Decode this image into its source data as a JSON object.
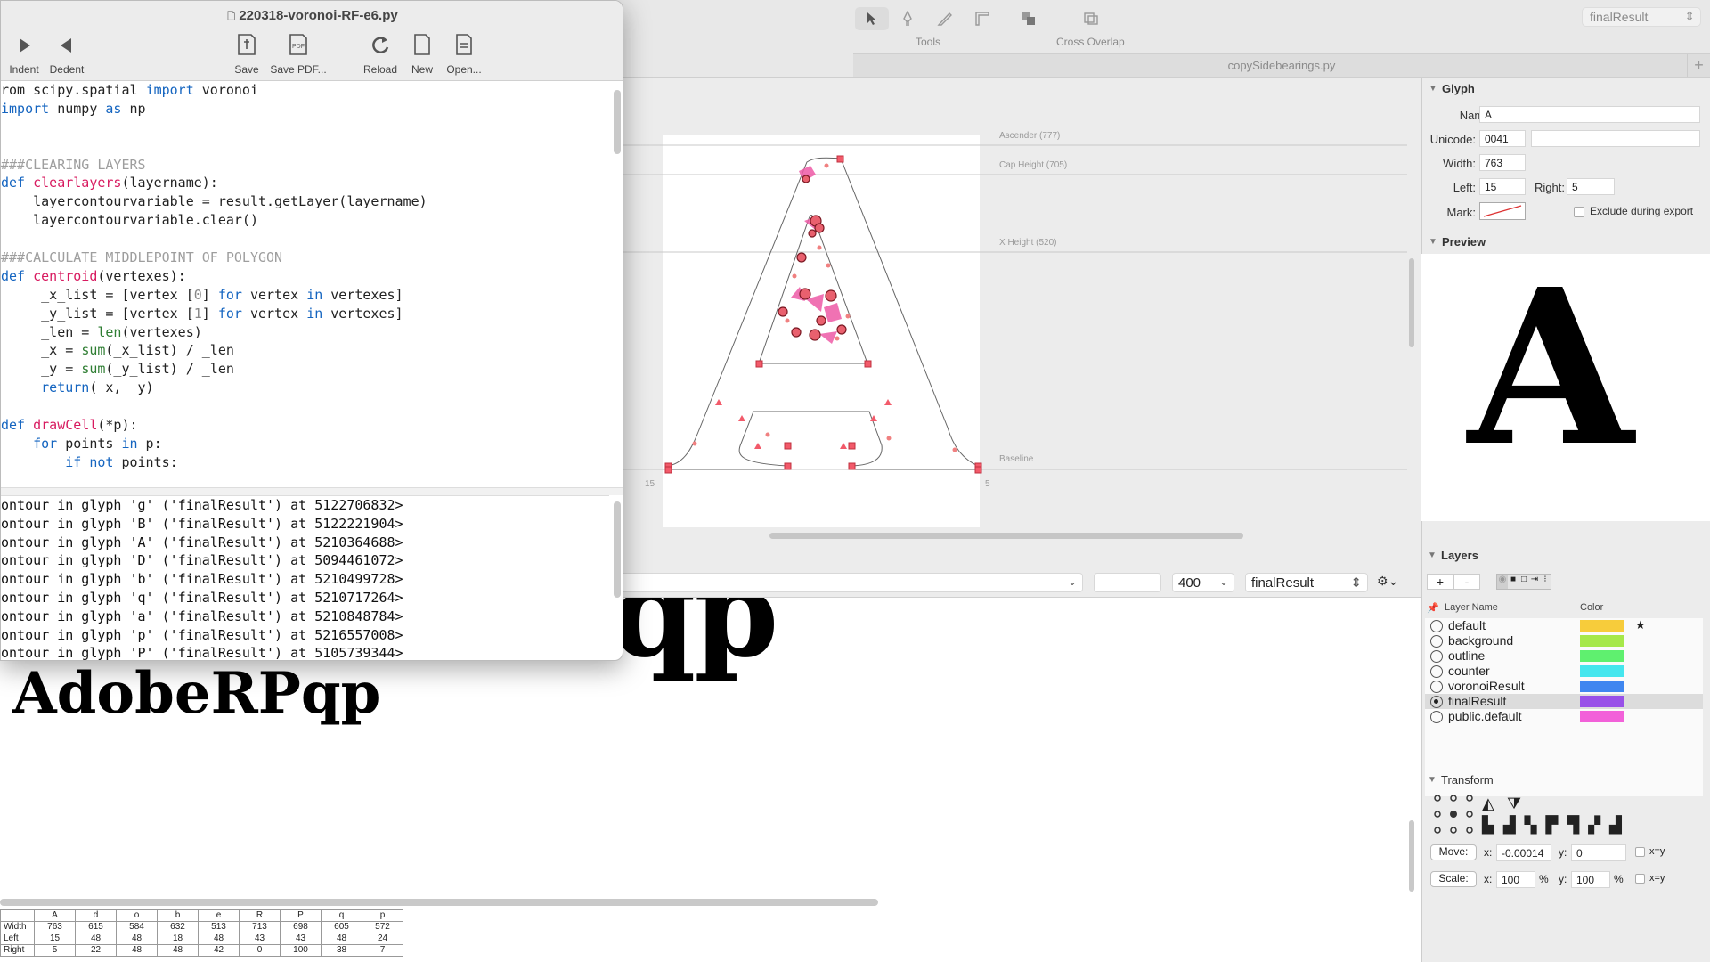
{
  "toolbar": {
    "tools_label": "Tools",
    "cross_overlap_label": "Cross Overlap",
    "layer_selector": "finalResult"
  },
  "tab": {
    "label": "copySidebearings.py",
    "add": "+"
  },
  "canvas": {
    "guides": {
      "ascender": "Ascender (777)",
      "cap_height": "Cap Height (705)",
      "x_height": "X Height (520)",
      "baseline": "Baseline"
    },
    "left_margin": "15",
    "right_margin": "5"
  },
  "mid_bar": {
    "size": "400",
    "layer": "finalResult"
  },
  "space_center": {
    "sample_large": "AdobeRPqp",
    "sample_small": "AdobeRPqp"
  },
  "metrics": {
    "headers": [
      "",
      "A",
      "d",
      "o",
      "b",
      "e",
      "R",
      "P",
      "q",
      "p"
    ],
    "rows": [
      [
        "Width",
        "763",
        "615",
        "584",
        "632",
        "513",
        "713",
        "698",
        "605",
        "572"
      ],
      [
        "Left",
        "15",
        "48",
        "48",
        "18",
        "48",
        "43",
        "43",
        "48",
        "24"
      ],
      [
        "Right",
        "5",
        "22",
        "48",
        "48",
        "42",
        "0",
        "100",
        "38",
        "7"
      ]
    ]
  },
  "inspector": {
    "glyph_title": "Glyph",
    "name_label": "Name:",
    "name_value": "A",
    "unicode_label": "Unicode:",
    "unicode_value": "0041",
    "width_label": "Width:",
    "width_value": "763",
    "left_label": "Left:",
    "left_value": "15",
    "right_label": "Right:",
    "right_value": "5",
    "mark_label": "Mark:",
    "exclude_label": "Exclude during export",
    "preview_title": "Preview",
    "preview_glyph": "A",
    "layers_title": "Layers",
    "add_layer": "+",
    "remove_layer": "-",
    "col_layer_name": "Layer Name",
    "col_color": "Color",
    "layers": [
      {
        "name": "default",
        "color": "#f7cc3b",
        "selected": false,
        "star": "★"
      },
      {
        "name": "background",
        "color": "#a6e84a",
        "selected": false,
        "star": ""
      },
      {
        "name": "outline",
        "color": "#5ff06f",
        "selected": false,
        "star": ""
      },
      {
        "name": "counter",
        "color": "#45e6ee",
        "selected": false,
        "star": ""
      },
      {
        "name": "voronoiResult",
        "color": "#3f86f0",
        "selected": false,
        "star": ""
      },
      {
        "name": "finalResult",
        "color": "#9850e8",
        "selected": true,
        "star": ""
      },
      {
        "name": "public.default",
        "color": "#f261d9",
        "selected": false,
        "star": ""
      }
    ],
    "transform_title": "Transform",
    "move_label": "Move:",
    "move_x_label": "x:",
    "move_x_value": "-0.00014",
    "move_y_label": "y:",
    "move_y_value": "0",
    "xy_label": "x=y",
    "scale_label": "Scale:",
    "scale_x_label": "x:",
    "scale_x_value": "100",
    "scale_y_label": "y:",
    "scale_y_value": "100",
    "percent": "%"
  },
  "editor": {
    "title": "220318-voronoi-RF-e6.py",
    "buttons": [
      "Indent",
      "Dedent",
      "Save",
      "Save PDF...",
      "Reload",
      "New",
      "Open..."
    ],
    "output_lines": [
      "ontour in glyph 'g' ('finalResult') at 5122706832>",
      "ontour in glyph 'B' ('finalResult') at 5122221904>",
      "ontour in glyph 'A' ('finalResult') at 5210364688>",
      "ontour in glyph 'D' ('finalResult') at 5094461072>",
      "ontour in glyph 'b' ('finalResult') at 5210499728>",
      "ontour in glyph 'q' ('finalResult') at 5210717264>",
      "ontour in glyph 'a' ('finalResult') at 5210848784>",
      "ontour in glyph 'p' ('finalResult') at 5216557008>",
      "ontour in glyph 'P' ('finalResult') at 5105739344>"
    ]
  },
  "code_lines": [
    {
      "seg": [
        [
          "",
          "rom scipy.spatial "
        ],
        [
          "kw",
          "import"
        ],
        [
          "",
          " voronoi"
        ]
      ]
    },
    {
      "seg": [
        [
          "kw",
          "import"
        ],
        [
          "",
          " numpy "
        ],
        [
          "kw",
          "as"
        ],
        [
          "",
          " np"
        ]
      ]
    },
    {
      "seg": []
    },
    {
      "seg": []
    },
    {
      "seg": [
        [
          "cm",
          "###CLEARING LAYERS"
        ]
      ]
    },
    {
      "seg": [
        [
          "kw",
          "def"
        ],
        [
          "fn",
          " clearlayers"
        ],
        [
          "",
          "(layername):"
        ]
      ]
    },
    {
      "seg": [
        [
          "",
          "    layercontourvariable = result.getLayer(layername)"
        ]
      ]
    },
    {
      "seg": [
        [
          "",
          "    layercontourvariable.clear()"
        ]
      ]
    },
    {
      "seg": []
    },
    {
      "seg": [
        [
          "cm",
          "###CALCULATE MIDDLEPOINT OF POLYGON"
        ]
      ]
    },
    {
      "seg": [
        [
          "kw",
          "def"
        ],
        [
          "fn",
          " centroid"
        ],
        [
          "",
          "(vertexes):"
        ]
      ]
    },
    {
      "seg": [
        [
          "",
          "     _x_list = [vertex ["
        ],
        [
          "nm",
          "0"
        ],
        [
          "",
          "] "
        ],
        [
          "kw",
          "for"
        ],
        [
          "",
          " vertex "
        ],
        [
          "kw",
          "in"
        ],
        [
          "",
          " vertexes]"
        ]
      ]
    },
    {
      "seg": [
        [
          "",
          "     _y_list = [vertex ["
        ],
        [
          "nm",
          "1"
        ],
        [
          "",
          "] "
        ],
        [
          "kw",
          "for"
        ],
        [
          "",
          " vertex "
        ],
        [
          "kw",
          "in"
        ],
        [
          "",
          " vertexes]"
        ]
      ]
    },
    {
      "seg": [
        [
          "",
          "     _len = "
        ],
        [
          "bi",
          "len"
        ],
        [
          "",
          "(vertexes)"
        ]
      ]
    },
    {
      "seg": [
        [
          "",
          "     _x = "
        ],
        [
          "bi",
          "sum"
        ],
        [
          "",
          "(_x_list) / _len"
        ]
      ]
    },
    {
      "seg": [
        [
          "",
          "     _y = "
        ],
        [
          "bi",
          "sum"
        ],
        [
          "",
          "(_y_list) / _len"
        ]
      ]
    },
    {
      "seg": [
        [
          "",
          "     "
        ],
        [
          "kw",
          "return"
        ],
        [
          "",
          "(_x, _y)"
        ]
      ]
    },
    {
      "seg": []
    },
    {
      "seg": [
        [
          "kw",
          "def"
        ],
        [
          "fn",
          " drawCell"
        ],
        [
          "",
          "(*p):"
        ]
      ]
    },
    {
      "seg": [
        [
          "",
          "    "
        ],
        [
          "kw",
          "for"
        ],
        [
          "",
          " points "
        ],
        [
          "kw",
          "in"
        ],
        [
          "",
          " p:"
        ]
      ]
    },
    {
      "seg": [
        [
          "",
          "        "
        ],
        [
          "kw",
          "if not"
        ],
        [
          "",
          " points:"
        ]
      ]
    }
  ]
}
